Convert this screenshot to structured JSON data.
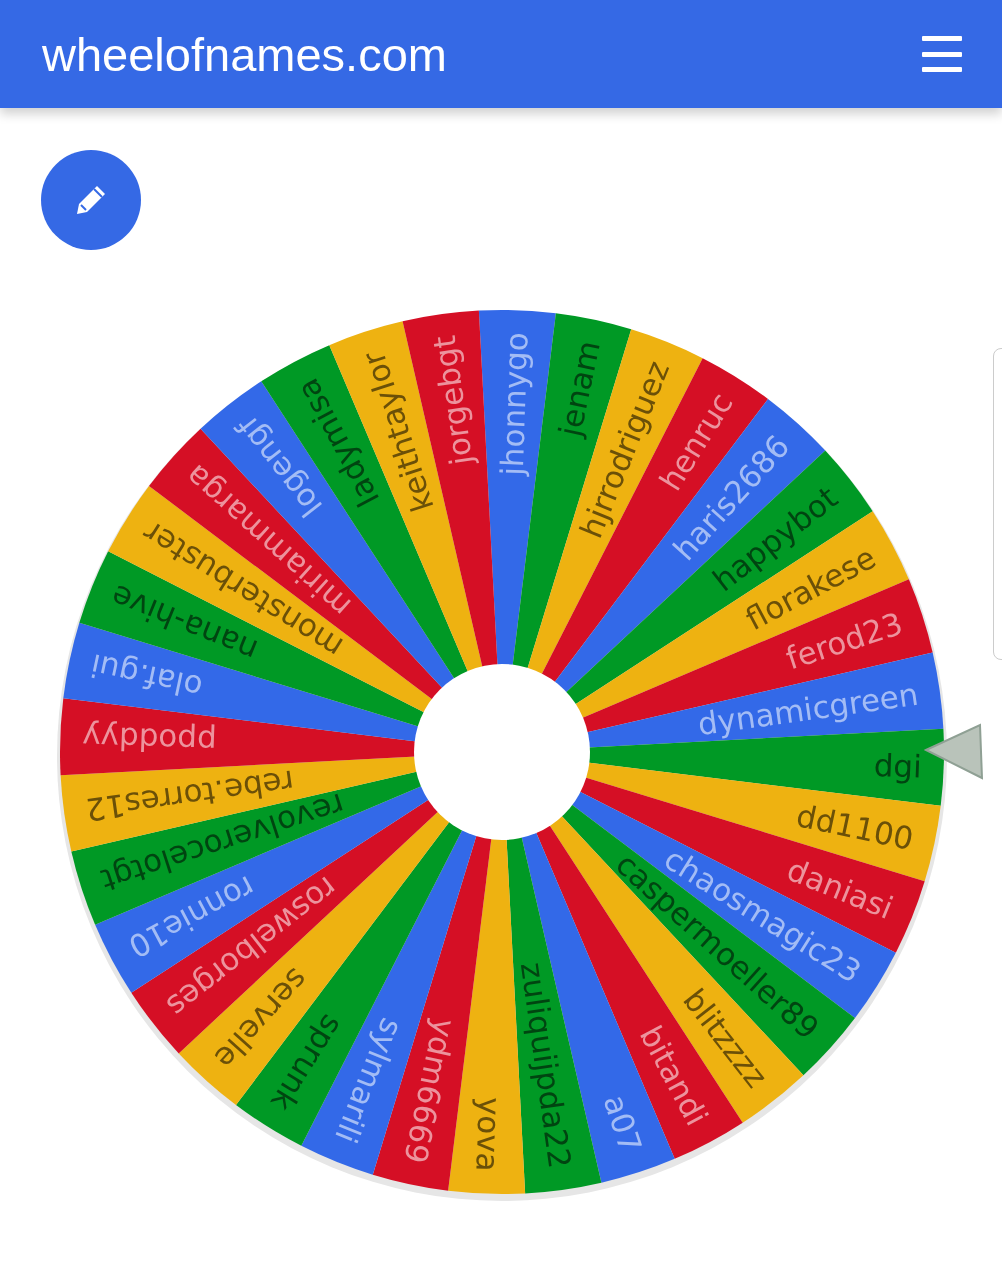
{
  "header": {
    "title": "wheelofnames.com"
  },
  "wheel": {
    "segments": [
      "jhonnygo",
      "jenam",
      "hjrrodriguez",
      "henruc",
      "haris2686",
      "happybot",
      "florakese",
      "ferod23",
      "dynamicgreen",
      "dgi",
      "dd1100",
      "daniasi",
      "chaosmagic23",
      "caspermoeller89",
      "blitzzzz",
      "bitandi",
      "a07",
      "zuliquijpda22",
      "yova",
      "ydm6669",
      "sylmarili",
      "sprunk",
      "servelle",
      "roswelborges",
      "ronnie10",
      "revolverocelotgt",
      "rebe.torres12",
      "ppoddyy",
      "olaf.gui",
      "nana-hive",
      "monsterbuster",
      "miriammarga",
      "logengf",
      "ladymisa",
      "keithtaylor",
      "jorgebgt"
    ]
  }
}
